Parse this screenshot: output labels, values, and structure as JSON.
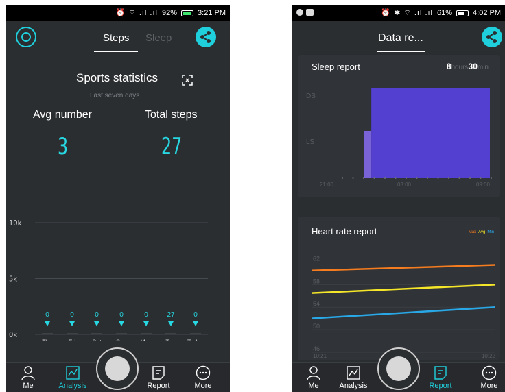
{
  "left": {
    "status": {
      "icons": "⏰ ⌔ .ıl .ıl",
      "battery": "92%",
      "time": "3:21 PM"
    },
    "tabs": [
      "Steps",
      "Sleep"
    ],
    "title": "Sports statistics",
    "subtitle": "Last seven days",
    "avg_label": "Avg number",
    "total_label": "Total steps",
    "avg_value": "3",
    "total_value": "27",
    "nav": [
      "Me",
      "Analysis",
      "Report",
      "More"
    ],
    "chart_data": {
      "type": "bar",
      "categories": [
        "Thu",
        "Fri",
        "Sat",
        "Sun",
        "Mon",
        "Tue",
        "Today"
      ],
      "values": [
        0,
        0,
        0,
        0,
        0,
        27,
        0
      ],
      "ytick_labels": [
        "0k",
        "5k",
        "10k"
      ],
      "ylim": [
        0,
        10000
      ],
      "grid": true
    }
  },
  "right": {
    "status": {
      "icons": "⏰ ✱ ⌔ .ıl .ıl",
      "battery": "61%",
      "time": "4:02 PM"
    },
    "tab": "Data re...",
    "nav": [
      "Me",
      "Analysis",
      "Report",
      "More"
    ],
    "sleep": {
      "title": "Sleep report",
      "hours": "8",
      "hours_unit": "hours",
      "minutes": "30",
      "minutes_unit": "min",
      "chart_data": {
        "type": "bar",
        "y_categories": [
          "DS",
          "LS"
        ],
        "xtick_labels": [
          "21:00",
          "03:00",
          "09:00"
        ],
        "segments": [
          {
            "stage": "LS",
            "start": 0.29,
            "end": 0.33,
            "color": "#7a63d6"
          },
          {
            "stage": "DS",
            "start": 0.33,
            "end": 1.0,
            "color": "#5440d0"
          }
        ]
      }
    },
    "heart": {
      "title": "Heart rate report",
      "legend": [
        "Max",
        "Avg",
        "Min"
      ],
      "legend_colors": [
        "#f57c1f",
        "#f5e629",
        "#29a8e8"
      ],
      "chart_data": {
        "type": "line",
        "ytick_labels": [
          "46",
          "50",
          "54",
          "58",
          "62"
        ],
        "ylim": [
          46,
          64
        ],
        "xtick_labels": [
          "10:21",
          "10:22"
        ],
        "series": [
          {
            "name": "Max",
            "values": [
              60.5,
              61.5
            ],
            "color": "#f57c1f"
          },
          {
            "name": "Avg",
            "values": [
              56.5,
              58.0
            ],
            "color": "#f5e629"
          },
          {
            "name": "Min",
            "values": [
              52.0,
              54.0
            ],
            "color": "#29a8e8"
          }
        ]
      }
    }
  }
}
